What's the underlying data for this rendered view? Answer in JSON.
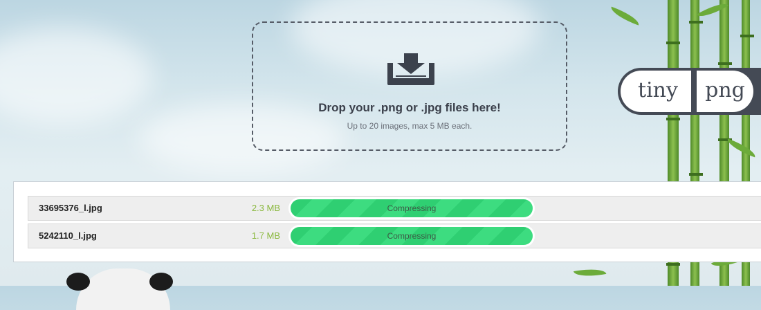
{
  "dropzone": {
    "title": "Drop your .png or .jpg files here!",
    "subtitle": "Up to 20 images, max 5 MB each.",
    "icon": "download-tray-icon"
  },
  "logo": {
    "part1": "tiny",
    "part2": "png"
  },
  "files": [
    {
      "name": "33695376_l.jpg",
      "size": "2.3 MB",
      "status": "Compressing"
    },
    {
      "name": "5242110_l.jpg",
      "size": "1.7 MB",
      "status": "Compressing"
    }
  ],
  "colors": {
    "progress": "#2fcf72",
    "size_text": "#8ab83e",
    "logo_dark": "#444a55"
  }
}
